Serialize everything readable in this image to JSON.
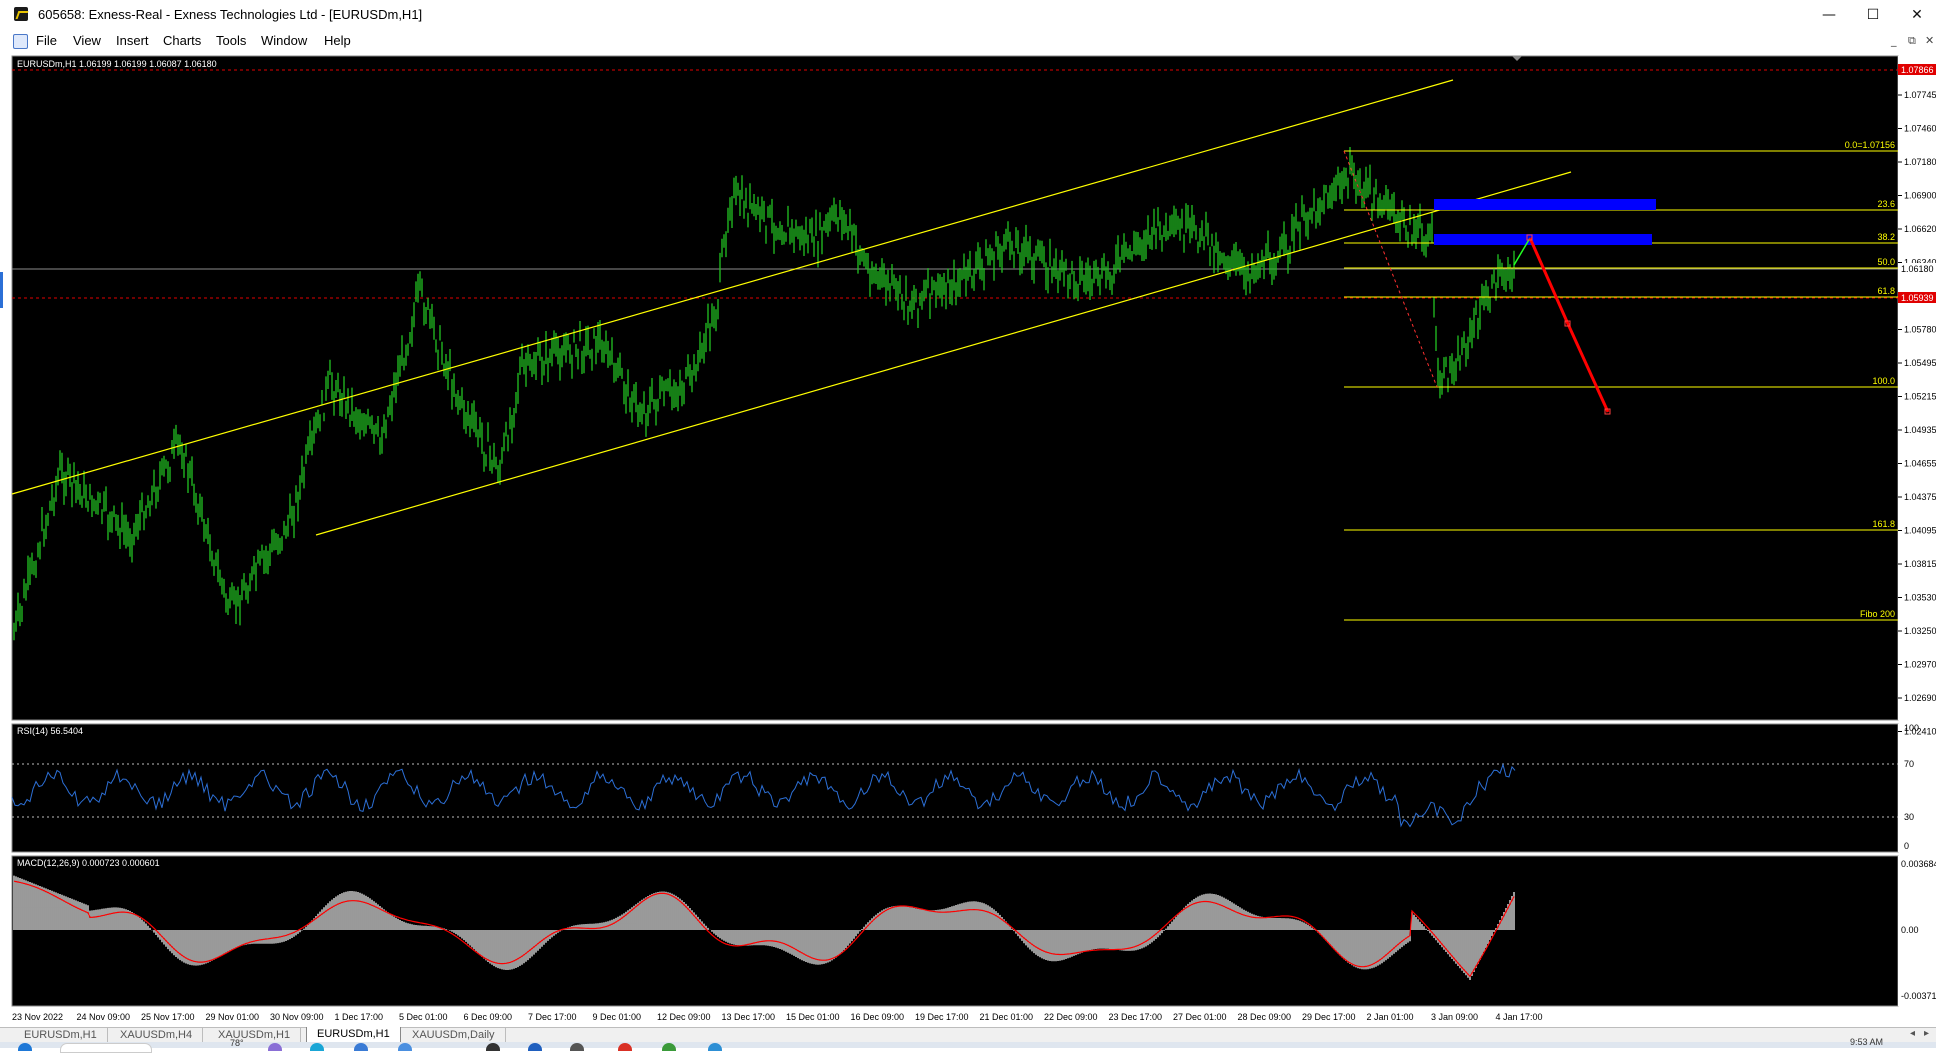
{
  "window": {
    "title": "605658: Exness-Real - Exness Technologies Ltd - [EURUSDm,H1]",
    "minimize": "—",
    "maximize": "☐",
    "close": "✕"
  },
  "menu": {
    "items": [
      "File",
      "View",
      "Insert",
      "Charts",
      "Tools",
      "Window",
      "Help"
    ],
    "mdi_controls": [
      "_",
      "⧉",
      "✕"
    ]
  },
  "chart": {
    "symbol_info": "EURUSDm,H1  1.06199 1.06199 1.06087 1.06180",
    "colors": {
      "background": "#000000",
      "candles": "#22c322",
      "channel": "#ffff00",
      "fibo": "#ffff00",
      "zones": "#0000ff",
      "projection": "#ff0000",
      "bid_line": "#8c8c8c",
      "rsi": "#2c6fd6",
      "macd_hist": "#c0c0c0",
      "macd_signal": "#ff0000"
    },
    "price_axis": [
      "1.07745",
      "1.07460",
      "1.07180",
      "1.06900",
      "1.06620",
      "1.06340",
      "1.06060",
      "1.05780",
      "1.05495",
      "1.05215",
      "1.04935",
      "1.04655",
      "1.04375",
      "1.04095",
      "1.03815",
      "1.03530",
      "1.03250",
      "1.02970",
      "1.02690",
      "1.02410"
    ],
    "price_tags": {
      "top_red": "1.07866",
      "current": "1.06180",
      "red_level": "1.05939"
    },
    "fibo_levels": [
      "0.0=1.07156",
      "23.6",
      "38.2",
      "50.0",
      "61.8",
      "100.0",
      "161.8",
      "Fibo 200"
    ],
    "time_axis": [
      "23 Nov 2022",
      "24 Nov 09:00",
      "25 Nov 17:00",
      "29 Nov 01:00",
      "30 Nov 09:00",
      "1 Dec 17:00",
      "5 Dec 01:00",
      "6 Dec 09:00",
      "7 Dec 17:00",
      "9 Dec 01:00",
      "12 Dec 09:00",
      "13 Dec 17:00",
      "15 Dec 01:00",
      "16 Dec 09:00",
      "19 Dec 17:00",
      "21 Dec 01:00",
      "22 Dec 09:00",
      "23 Dec 17:00",
      "27 Dec 01:00",
      "28 Dec 09:00",
      "29 Dec 17:00",
      "2 Jan 01:00",
      "3 Jan 09:00",
      "4 Jan 17:00"
    ]
  },
  "rsi": {
    "label": "RSI(14) 56.5404",
    "axis": [
      "100",
      "70",
      "30",
      "0"
    ]
  },
  "macd": {
    "label": "MACD(12,26,9) 0.000723 0.000601",
    "axis": [
      "0.003684",
      "0.00",
      "-0.00371"
    ]
  },
  "tabs": {
    "items": [
      "EURUSDm,H1",
      "XAUUSDm,H4",
      "XAUUSDm,H1",
      "EURUSDm,H1",
      "XAUUSDm,Daily"
    ],
    "active_index": 3
  },
  "taskbar": {
    "weather": "78°",
    "clock": "9:53 AM"
  }
}
